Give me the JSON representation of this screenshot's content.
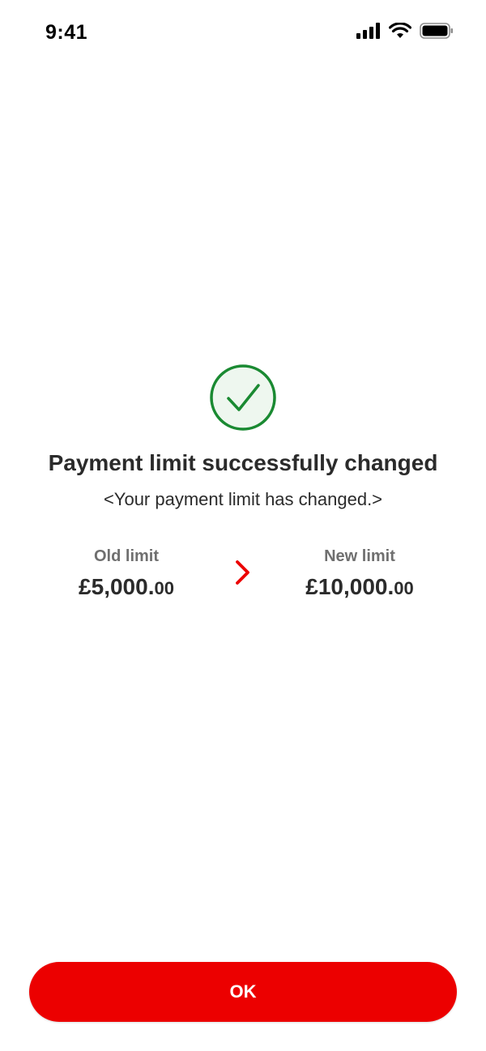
{
  "status_bar": {
    "time": "9:41",
    "icons": [
      "signal-icon",
      "wifi-icon",
      "battery-icon"
    ]
  },
  "success": {
    "icon": "check-circle-icon",
    "title": "Payment limit successfully changed",
    "subtitle": "<Your payment limit has changed.>"
  },
  "limits": {
    "old": {
      "label": "Old limit",
      "pounds": "£5,000.",
      "pence": "00"
    },
    "arrow_icon": "chevron-right-icon",
    "new": {
      "label": "New limit",
      "pounds": "£10,000.",
      "pence": "00"
    }
  },
  "actions": {
    "ok_label": "OK"
  },
  "colors": {
    "primary": "#ec0000",
    "success_green": "#1a8a32",
    "success_fill": "#eef7ef"
  }
}
